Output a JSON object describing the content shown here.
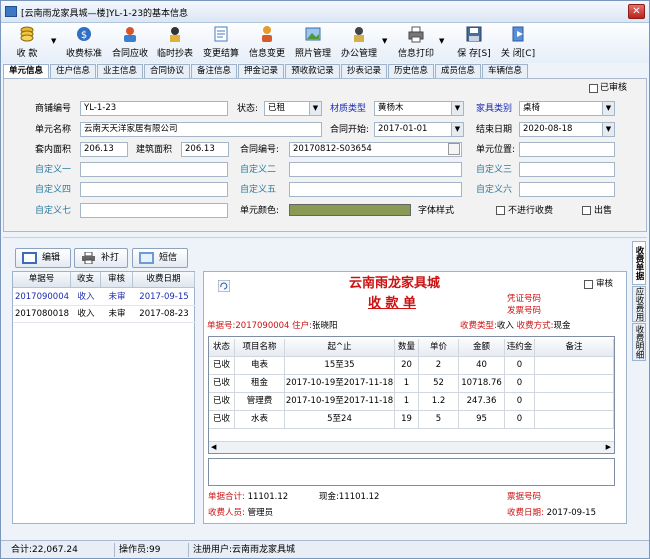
{
  "window": {
    "title": "[云南雨龙家具城—楼]YL-1-23的基本信息"
  },
  "toolbar": [
    {
      "label": "收 款",
      "icon": "coins-icon"
    },
    {
      "label": "收费标准",
      "icon": "dollar-icon"
    },
    {
      "label": "合同应收",
      "icon": "contract-receivable-icon"
    },
    {
      "label": "临时抄表",
      "icon": "meter-icon"
    },
    {
      "label": "变更结算",
      "icon": "settlement-icon"
    },
    {
      "label": "信息变更",
      "icon": "person-edit-icon"
    },
    {
      "label": "照片管理",
      "icon": "photo-icon"
    },
    {
      "label": "办公管理",
      "icon": "office-icon"
    },
    {
      "label": "信息打印",
      "icon": "printer-icon"
    },
    {
      "label": "保 存[S]",
      "icon": "save-icon"
    },
    {
      "label": "关 闭[C]",
      "icon": "exit-icon"
    }
  ],
  "tabs": [
    "单元信息",
    "住户信息",
    "业主信息",
    "合同协议",
    "备注信息",
    "押金记录",
    "预收款记录",
    "抄表记录",
    "历史信息",
    "成员信息",
    "车辆信息"
  ],
  "form": {
    "reviewed_label": "已审核",
    "shop_no_label": "商铺编号",
    "shop_no": "YL-1-23",
    "status_label": "状态:",
    "status": "已租",
    "material_label": "材质类型",
    "material": "黄杨木",
    "furniture_label": "家具类别",
    "furniture": "桌椅",
    "unit_name_label": "单元名称",
    "unit_name": "云南天天洋家居有限公司",
    "contract_start_label": "合同开始:",
    "contract_start": "2017-01-01",
    "end_date_label": "结束日期",
    "end_date": "2020-08-18",
    "inner_area_label": "套内面积",
    "inner_area": "206.13",
    "build_area_label": "建筑面积",
    "build_area": "206.13",
    "contract_no_label": "合同编号:",
    "contract_no": "20170812-S03654",
    "unit_pos_label": "单元位置:",
    "unit_pos": "",
    "custom1": "自定义一",
    "custom2": "自定义二",
    "custom3": "自定义三",
    "custom4": "自定义四",
    "custom5": "自定义五",
    "custom6": "自定义六",
    "custom7": "自定义七",
    "unit_color_label": "单元颜色:",
    "unit_color": "#8a9a55",
    "font_style_label": "字体样式",
    "no_fee_label": "不进行收费",
    "sale_label": "出售"
  },
  "actions": {
    "edit": "编辑",
    "reprint": "补打",
    "sms": "短信"
  },
  "receipt_list": {
    "headers": [
      "单据号",
      "收支",
      "审核",
      "收费日期"
    ],
    "rows": [
      [
        "2017090004",
        "收入",
        "未审",
        "2017-09-15"
      ],
      [
        "2017080018",
        "收入",
        "未审",
        "2017-08-23"
      ]
    ]
  },
  "receipt": {
    "company": "云南雨龙家具城",
    "title": "收 款 单",
    "reviewed_label": "审核",
    "voucher_label": "凭证号码",
    "invoice_label": "发票号码",
    "doc_no_label": "单据号:",
    "doc_no": "2017090004",
    "resident_label": "住户:",
    "resident": "张晓阳",
    "fee_type_label": "收费类型:",
    "fee_type": "收入",
    "pay_method_label": "收费方式:",
    "pay_method": "现金",
    "headers": [
      "状态",
      "项目名称",
      "起^止",
      "数量",
      "单价",
      "金额",
      "违约金",
      "备注"
    ],
    "rows": [
      [
        "已收",
        "电表",
        "15至35",
        "20",
        "2",
        "40",
        "0",
        ""
      ],
      [
        "已收",
        "租金",
        "2017-10-19至2017-11-18",
        "1",
        "52",
        "10718.76",
        "0",
        ""
      ],
      [
        "已收",
        "管理费",
        "2017-10-19至2017-11-18",
        "1",
        "1.2",
        "247.36",
        "0",
        ""
      ],
      [
        "已收",
        "水表",
        "5至24",
        "19",
        "5",
        "95",
        "0",
        ""
      ]
    ],
    "total_label": "单据合计:",
    "total": "11101.12",
    "cash_label": "现金:",
    "cash": "11101.12",
    "ticket_label": "票据号码",
    "collector_label": "收费人员:",
    "collector": "管理员",
    "fee_date_label": "收费日期:",
    "fee_date": "2017-09-15"
  },
  "side_tabs": [
    "收费单据",
    "应收费用",
    "收费明细"
  ],
  "status": {
    "total": "合计:22,067.24",
    "operator": "操作员:99",
    "registered": "注册用户:云南雨龙家具城"
  }
}
